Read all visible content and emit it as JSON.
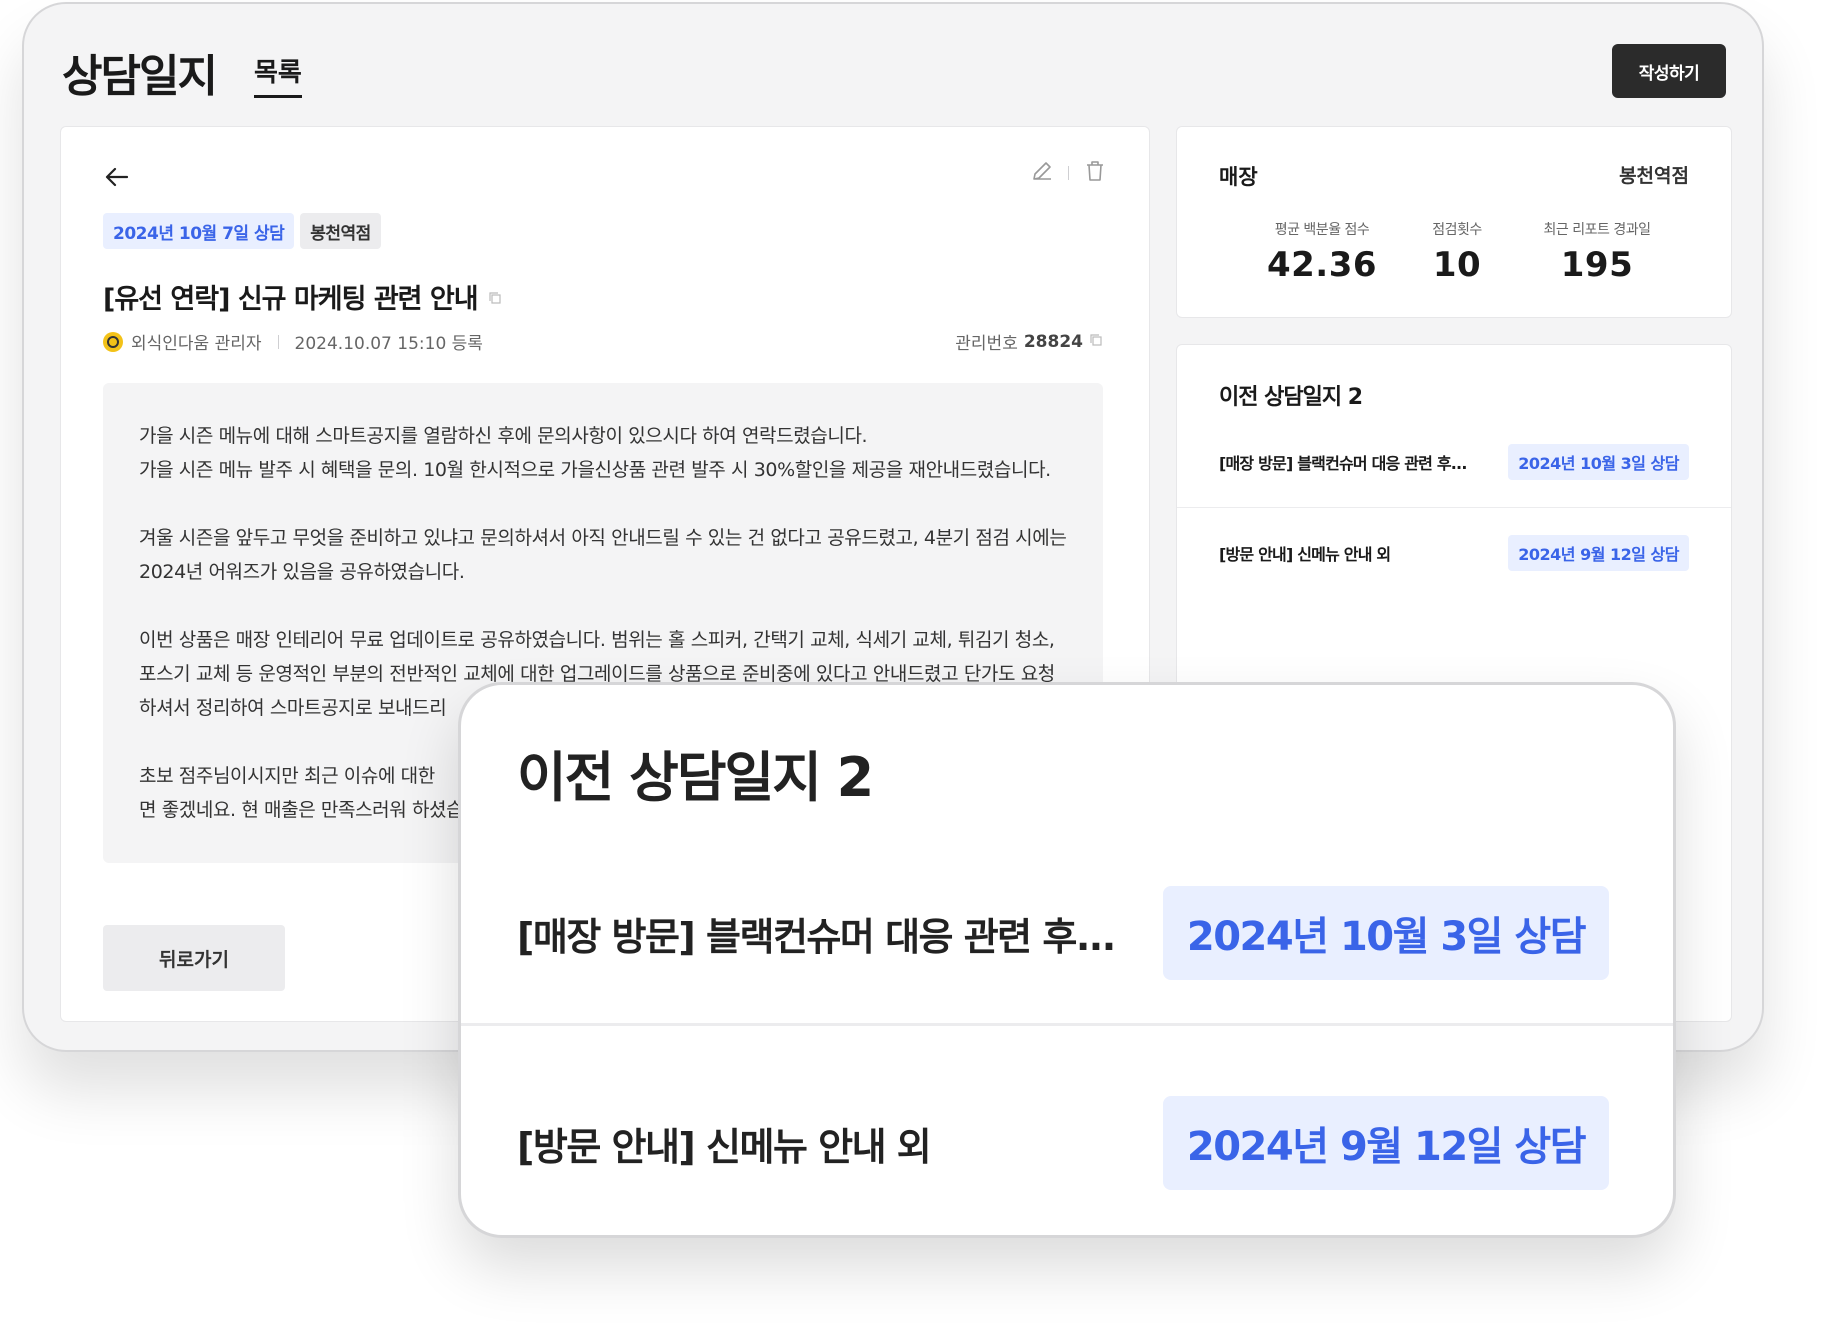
{
  "header": {
    "app_title": "상담일지",
    "tab_list": "목록",
    "write_button": "작성하기"
  },
  "post": {
    "date_chip": "2024년 10월 7일 상담",
    "store_chip": "봉천역점",
    "title": "[유선 연락] 신규 마케팅 관련 안내",
    "author": "외식인다움 관리자",
    "registered": "2024.10.07 15:10 등록",
    "mgmt_label": "관리번호",
    "mgmt_no": "28824",
    "paragraphs": [
      "가을 시즌 메뉴에 대해 스마트공지를 열람하신 후에 문의사항이 있으시다 하여 연락드렸습니다.\n가을 시즌 메뉴 발주 시 혜택을 문의. 10월 한시적으로 가을신상품 관련 발주 시 30%할인을 제공을 재안내드렸습니다.",
      "겨울 시즌을 앞두고 무엇을 준비하고 있냐고 문의하셔서 아직 안내드릴 수 있는 건 없다고 공유드렸고, 4분기 점검 시에는 2024년 어워즈가 있음을 공유하였습니다.",
      "이번 상품은 매장 인테리어 무료 업데이트로 공유하였습니다. 범위는 홀 스피커, 간택기 교체, 식세기 교체, 튀김기 청소, 포스기 교체 등 운영적인 부분의 전반적인 교체에 대한 업그레이드를 상품으로 준비중에 있다고 안내드렸고 단가도 요청하셔서 정리하여 스마트공지로 보내드리",
      "초보 점주님이시지만 최근 이슈에 대한 \n면 좋겠네요. 현 매출은 만족스러워 하셨습"
    ],
    "back_button": "뒤로가기"
  },
  "store": {
    "label": "매장",
    "name": "봉천역점",
    "stats": [
      {
        "label": "평균 백분율 점수",
        "value": "42.36"
      },
      {
        "label": "점검횟수",
        "value": "10"
      },
      {
        "label": "최근 리포트 경과일",
        "value": "195"
      }
    ]
  },
  "previous": {
    "heading": "이전 상담일지 2",
    "items": [
      {
        "title": "[매장 방문] 블랙컨슈머 대응 관련 후...",
        "date": "2024년 10월 3일 상담"
      },
      {
        "title": "[방문 안내] 신메뉴 안내 외",
        "date": "2024년 9월 12일 상담"
      }
    ]
  },
  "icons": {
    "back": "arrow-left-icon",
    "edit": "pencil-icon",
    "delete": "trash-icon",
    "copy": "copy-icon",
    "avatar": "avatar-icon"
  },
  "colors": {
    "accent_blue": "#3a64e8",
    "chip_blue_bg": "#e9efff",
    "dark_button": "#2b2b2b",
    "avatar_yellow": "#f3c218"
  }
}
